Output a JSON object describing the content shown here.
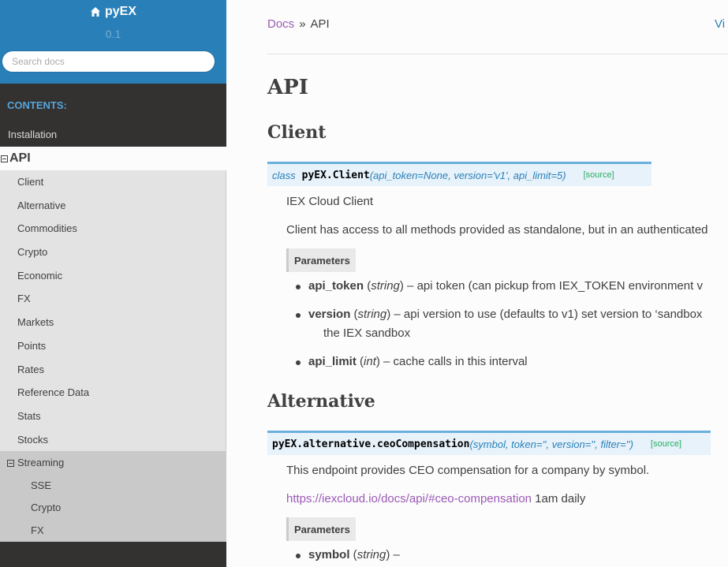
{
  "sidebar": {
    "project": "pyEX",
    "version": "0.1",
    "search_placeholder": "Search docs",
    "caption": "CONTENTS:",
    "installation": "Installation",
    "api": "API",
    "api_items": [
      "Client",
      "Alternative",
      "Commodities",
      "Crypto",
      "Economic",
      "FX",
      "Markets",
      "Points",
      "Rates",
      "Reference Data",
      "Stats",
      "Stocks"
    ],
    "streaming": "Streaming",
    "streaming_items": [
      "SSE",
      "Crypto",
      "FX"
    ]
  },
  "breadcrumb": {
    "docs": "Docs",
    "sep": "»",
    "current": "API",
    "view": "Vi"
  },
  "page": {
    "title": "API",
    "client": {
      "heading": "Client",
      "keyword": "class",
      "name": "pyEX.Client",
      "params": "(api_token=None, version='v1', api_limit=5)",
      "source": "[source]",
      "desc1": "IEX Cloud Client",
      "desc2": "Client has access to all methods provided as standalone, but in an authenticated",
      "parameters_label": "Parameters",
      "p1_name": "api_token",
      "p1_type": "string",
      "p1_desc": " – api token (can pickup from IEX_TOKEN environment v",
      "p2_name": "version",
      "p2_type": "string",
      "p2_desc": " – api version to use (defaults to v1) set version to ‘sandbox",
      "p2_desc2": "the IEX sandbox",
      "p3_name": "api_limit",
      "p3_type": "int",
      "p3_desc": " – cache calls in this interval"
    },
    "alternative": {
      "heading": "Alternative",
      "name": "pyEX.alternative.ceoCompensation",
      "params": "(symbol, token='', version='', filter='')",
      "source": "[source]",
      "desc": "This endpoint provides CEO compensation for a company by symbol.",
      "link": "https://iexcloud.io/docs/api/#ceo-compensation",
      "link_suffix": " 1am daily",
      "parameters_label": "Parameters",
      "p1_name": "symbol",
      "p1_type": "string",
      "p1_desc": " –"
    }
  }
}
